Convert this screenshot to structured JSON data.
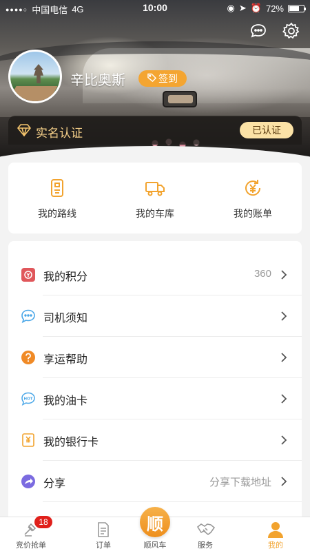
{
  "status_bar": {
    "carrier": "中国电信",
    "network": "4G",
    "time": "10:00",
    "battery": "72%",
    "battery_level": 0.72
  },
  "header": {
    "username": "辛比奥斯",
    "checkin_label": "签到",
    "icons": [
      "message-icon",
      "settings-icon"
    ]
  },
  "verification": {
    "label": "实名认证",
    "status": "已认证"
  },
  "quick_actions": [
    {
      "label": "我的路线",
      "icon": "route-icon"
    },
    {
      "label": "我的车库",
      "icon": "truck-icon"
    },
    {
      "label": "我的账单",
      "icon": "bill-icon"
    }
  ],
  "menu": [
    {
      "label": "我的积分",
      "value": "360",
      "icon": "points-icon",
      "color": "#e0575b"
    },
    {
      "label": "司机须知",
      "value": "",
      "icon": "notice-icon",
      "color": "#4aa7e8"
    },
    {
      "label": "享运帮助",
      "value": "",
      "icon": "help-icon",
      "color": "#f08a26"
    },
    {
      "label": "我的油卡",
      "value": "",
      "icon": "fuel-card-icon",
      "color": "#4aa7e8"
    },
    {
      "label": "我的银行卡",
      "value": "",
      "icon": "bank-card-icon",
      "color": "#f2a32e"
    },
    {
      "label": "分享",
      "value": "分享下载地址",
      "icon": "share-icon",
      "color": "#7b6be0"
    }
  ],
  "tabbar": {
    "items": [
      {
        "label": "竞价抢单",
        "icon": "bid-icon",
        "badge": "18"
      },
      {
        "label": "订单",
        "icon": "order-icon"
      },
      {
        "label": "顺风车",
        "icon": "ride-icon",
        "center_char": "顺"
      },
      {
        "label": "服务",
        "icon": "service-icon"
      },
      {
        "label": "我的",
        "icon": "profile-icon",
        "active": true
      }
    ]
  },
  "colors": {
    "accent": "#f2a32e",
    "badge": "#e0201b",
    "verified_bg": "#fbe2a6"
  }
}
